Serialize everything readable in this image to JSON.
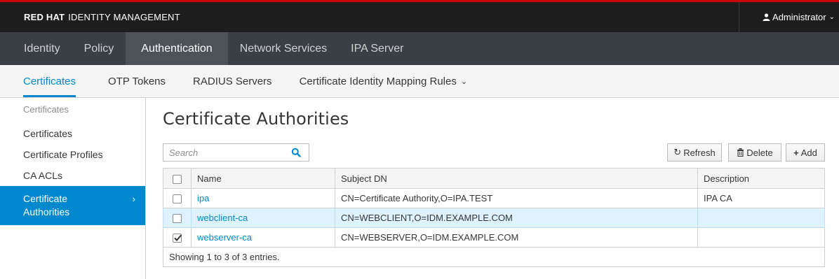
{
  "brand": {
    "bold": "RED HAT",
    "rest": "IDENTITY MANAGEMENT"
  },
  "user": {
    "name": "Administrator"
  },
  "nav_primary": [
    {
      "label": "Identity"
    },
    {
      "label": "Policy"
    },
    {
      "label": "Authentication",
      "active": true
    },
    {
      "label": "Network Services"
    },
    {
      "label": "IPA Server"
    }
  ],
  "nav_secondary": [
    {
      "label": "Certificates",
      "active": true
    },
    {
      "label": "OTP Tokens"
    },
    {
      "label": "RADIUS Servers"
    },
    {
      "label": "Certificate Identity Mapping Rules"
    }
  ],
  "sidebar": {
    "heading": "Certificates",
    "items": [
      {
        "label": "Certificates"
      },
      {
        "label": "Certificate Profiles"
      },
      {
        "label": "CA ACLs"
      },
      {
        "label": "Certificate Authorities",
        "active": true
      }
    ]
  },
  "page": {
    "title": "Certificate Authorities"
  },
  "search": {
    "placeholder": "Search",
    "value": ""
  },
  "toolbar": {
    "refresh": "Refresh",
    "delete": "Delete",
    "add": "Add"
  },
  "table": {
    "headers": {
      "name": "Name",
      "subject": "Subject DN",
      "description": "Description"
    },
    "rows": [
      {
        "name": "ipa",
        "subject": "CN=Certificate Authority,O=IPA.TEST",
        "description": "IPA CA",
        "checked": false
      },
      {
        "name": "webclient-ca",
        "subject": "CN=WEBCLIENT,O=IDM.EXAMPLE.COM",
        "description": "",
        "checked": false
      },
      {
        "name": "webserver-ca",
        "subject": "CN=WEBSERVER,O=IDM.EXAMPLE.COM",
        "description": "",
        "checked": true
      }
    ],
    "footer": "Showing 1 to 3 of 3 entries."
  },
  "colors": {
    "accent": "#0088ce",
    "brand_red": "#cc0000",
    "highlight_row": "#def3ff"
  },
  "icons": [
    "user-icon",
    "chevron-down-icon",
    "search-icon",
    "refresh-icon",
    "trash-icon",
    "plus-icon",
    "chevron-right-icon",
    "checkbox-icon"
  ]
}
